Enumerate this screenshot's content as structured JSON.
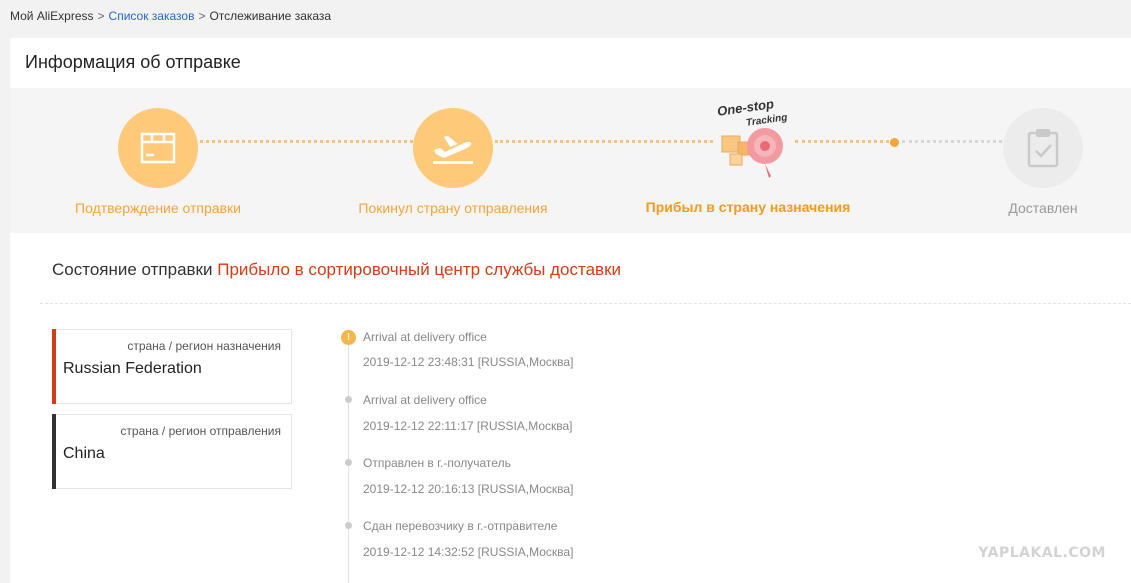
{
  "breadcrumb": {
    "home": "Мой AliExpress",
    "separator": ">",
    "orders": "Список заказов",
    "current": "Отслеживание заказа"
  },
  "panel": {
    "title": "Информация об отправке"
  },
  "stepper": {
    "accent_color": "#ffc97a",
    "badge": {
      "line1": "One-stop",
      "line2": "Tracking"
    },
    "steps": [
      {
        "label": "Подтверждение отправки",
        "icon": "package-icon",
        "state": "done"
      },
      {
        "label": "Покинул страну отправления",
        "icon": "plane-takeoff-icon",
        "state": "done"
      },
      {
        "label": "Прибыл в страну назначения",
        "icon": "one-stop-tracking-icon",
        "state": "current"
      },
      {
        "label": "Доставлен",
        "icon": "clipboard-check-icon",
        "state": "pending"
      }
    ]
  },
  "status": {
    "label": "Состояние отправки",
    "value": "Прибыло в сортировочный центр службы доставки",
    "value_color": "#d23c17"
  },
  "regions": {
    "destination": {
      "caption": "страна / регион назначения",
      "value": "Russian Federation",
      "bar_color": "#d23c17"
    },
    "origin": {
      "caption": "страна / регион отправления",
      "value": "China",
      "bar_color": "#333333"
    }
  },
  "timeline": {
    "first_marker": "!",
    "events": [
      {
        "event": "Arrival at delivery office",
        "time": "2019-12-12 23:48:31 [RUSSIA,Москва]"
      },
      {
        "event": "Arrival at delivery office",
        "time": "2019-12-12 22:11:17 [RUSSIA,Москва]"
      },
      {
        "event": "Отправлен в г.-получатель",
        "time": "2019-12-12 20:16:13 [RUSSIA,Москва]"
      },
      {
        "event": "Сдан перевозчику в г.-отправителе",
        "time": "2019-12-12 14:32:52 [RUSSIA,Москва]"
      }
    ]
  },
  "watermark": "YAPLAKAL.COM"
}
